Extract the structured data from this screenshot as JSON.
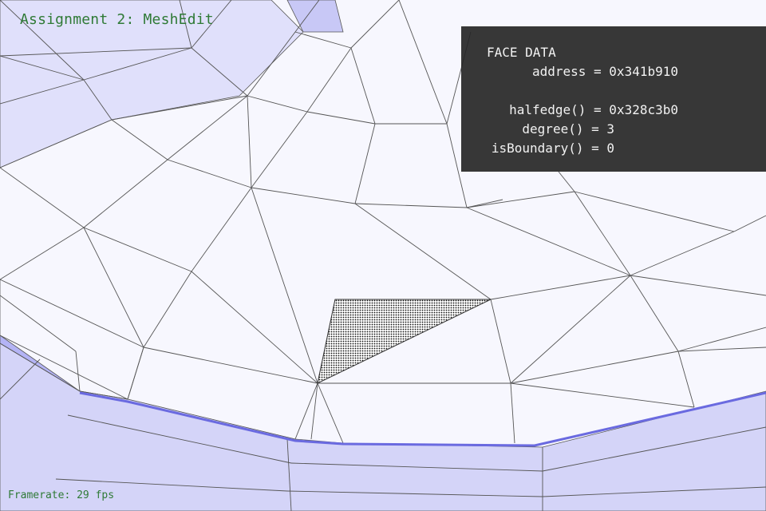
{
  "app": {
    "title": "Assignment 2: MeshEdit",
    "framerate": "Framerate: 29 fps"
  },
  "face_panel": {
    "heading": "FACE DATA",
    "rows": [
      {
        "text": "address = 0x341b910"
      },
      {
        "text": ""
      },
      {
        "text": "halfedge() = 0x328c3b0"
      },
      {
        "text": "degree() = 3"
      },
      {
        "text": "isBoundary() = 0"
      }
    ]
  },
  "colors": {
    "mesh_edge": "#555555",
    "mesh_light": "#f7f7fe",
    "mesh_shadow": "#8a8af0",
    "selected_face_hatch": "#000000",
    "panel_bg": "#262626",
    "overlay_text": "#2f7a36"
  }
}
